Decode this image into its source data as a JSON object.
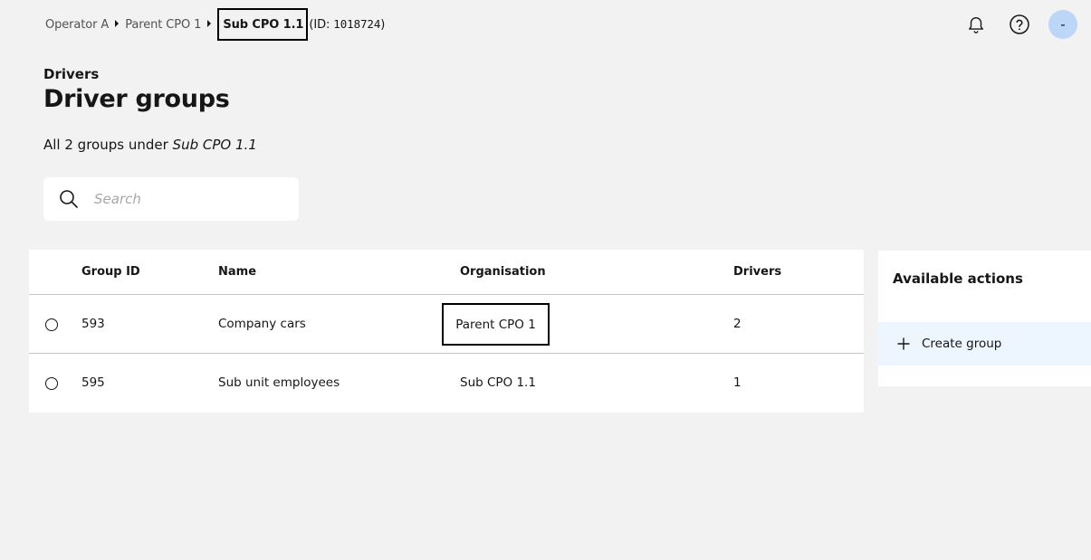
{
  "breadcrumb": {
    "items": [
      "Operator A",
      "Parent CPO 1"
    ],
    "current": "Sub CPO 1.1",
    "id_prefix": "(ID: ",
    "id_value": "1018724",
    "id_suffix": ")"
  },
  "header": {
    "notification_icon": "bell-icon",
    "help_icon": "help-circle-icon",
    "avatar_text": "-",
    "avatar_color": "#bcd6f7"
  },
  "section_label": "Drivers",
  "page_title": "Driver groups",
  "subtitle": {
    "prefix": "All 2 groups under",
    "org": "Sub CPO 1.1"
  },
  "search": {
    "placeholder": "Search",
    "value": ""
  },
  "table": {
    "columns": [
      "Group ID",
      "Name",
      "Organisation",
      "Drivers"
    ],
    "rows": [
      {
        "group_id": "593",
        "name": "Company cars",
        "organisation": "Parent CPO 1",
        "drivers": "2"
      },
      {
        "group_id": "595",
        "name": "Sub unit employees",
        "organisation": "Sub CPO 1.1",
        "drivers": "1"
      }
    ]
  },
  "actions": {
    "title": "Available actions",
    "items": [
      {
        "label": "Create group",
        "icon": "plus-icon"
      }
    ],
    "highlight_color": "#edf5ff"
  }
}
